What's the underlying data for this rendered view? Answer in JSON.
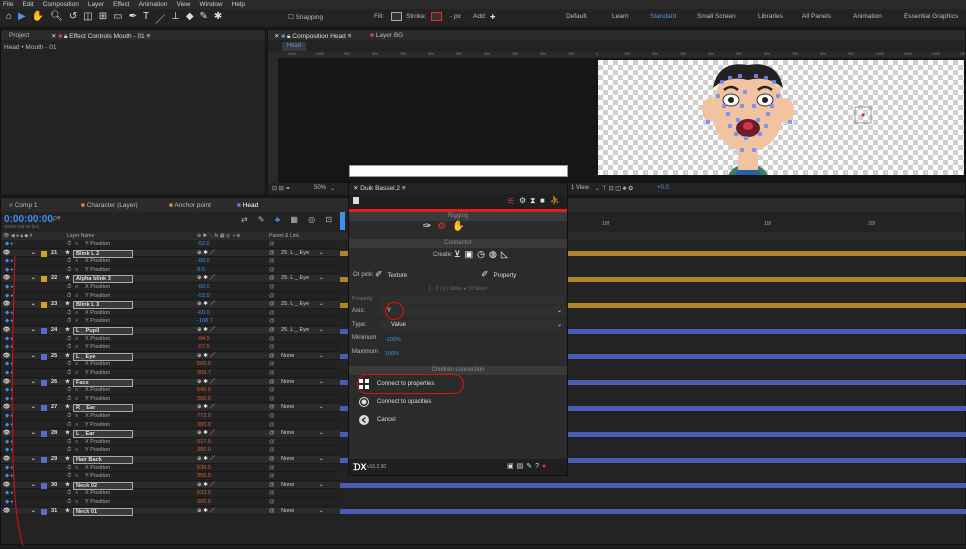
{
  "menu": [
    "File",
    "Edit",
    "Composition",
    "Layer",
    "Effect",
    "Animation",
    "View",
    "Window",
    "Help"
  ],
  "toolbar": {
    "snapping": "Snapping",
    "fill": "Fill:",
    "stroke": "Stroke:",
    "px": "- px",
    "add": "Add:",
    "workspaces": [
      "Default",
      "Learn",
      "Standard",
      "Small Screen",
      "Libraries",
      "All Panels",
      "Animation",
      "Essential Graphics"
    ],
    "active_workspace": "Standard"
  },
  "project": {
    "tab": "Project",
    "effect_tab": "Effect Controls Mouth - 01",
    "subtitle": "Head • Mouth - 01"
  },
  "composition": {
    "tab": "Composition Head",
    "layer_tab": "Layer BG",
    "comp_btn": "Head",
    "zoom": "50%",
    "view": "1 View",
    "offset": "+0.0",
    "ruler_ticks": [
      "1100",
      "1000",
      "900",
      "800",
      "700",
      "600",
      "500",
      "400",
      "300",
      "200",
      "100",
      "0",
      "100",
      "200",
      "300",
      "400",
      "500",
      "600",
      "700",
      "800",
      "900",
      "1000",
      "1100",
      "1200",
      "1300"
    ]
  },
  "timeline": {
    "tabs": [
      "Comp 1",
      "Character (Layer)",
      "Anchor point",
      "Head"
    ],
    "timecode": "0:00:00:00",
    "fps": "00000 (25.00 fps)",
    "col_headers": {
      "layer_name": "Layer Name",
      "parent": "Parent & Link"
    },
    "ruler": [
      "10f",
      "15f",
      "20f"
    ],
    "rows": [
      {
        "kind": "prop",
        "name": "Y Position",
        "value": "-52.0",
        "vclass": ""
      },
      {
        "kind": "layer",
        "num": "21",
        "name": "Blink L 2",
        "parent": "25. L _ Eye",
        "color": "#d3a020"
      },
      {
        "kind": "prop",
        "name": "X Position",
        "value": "-60.0",
        "vclass": ""
      },
      {
        "kind": "prop",
        "name": "Y Position",
        "value": "8.0",
        "vclass": ""
      },
      {
        "kind": "layer",
        "num": "22",
        "name": "Alpha blink 3",
        "parent": "25. L _ Eye",
        "color": "#d3a020"
      },
      {
        "kind": "prop",
        "name": "X Position",
        "value": "-60.0",
        "vclass": ""
      },
      {
        "kind": "prop",
        "name": "Y Position",
        "value": "-52.0",
        "vclass": ""
      },
      {
        "kind": "layer",
        "num": "23",
        "name": "Blink L 3",
        "parent": "25. L _ Eye",
        "color": "#d3a020"
      },
      {
        "kind": "prop",
        "name": "X Position",
        "value": "-60.0",
        "vclass": ""
      },
      {
        "kind": "prop",
        "name": "Y Position",
        "value": "-108.7",
        "vclass": ""
      },
      {
        "kind": "layer",
        "num": "24",
        "name": "L _ Pupil",
        "parent": "25. L _ Eye",
        "color": "#5a6ad0"
      },
      {
        "kind": "prop",
        "name": "X Position",
        "value": "-94.5",
        "vclass": "red"
      },
      {
        "kind": "prop",
        "name": "Y Position",
        "value": "-57.5",
        "vclass": "red"
      },
      {
        "kind": "layer",
        "num": "25",
        "name": "L _ Eye",
        "parent": "None",
        "color": "#5a6ad0"
      },
      {
        "kind": "prop",
        "name": "X Position",
        "value": "565.0",
        "vclass": "red"
      },
      {
        "kind": "prop",
        "name": "Y Position",
        "value": "305.7",
        "vclass": "red"
      },
      {
        "kind": "layer",
        "num": "26",
        "name": "Face",
        "parent": "None",
        "color": "#5a6ad0"
      },
      {
        "kind": "prop",
        "name": "X Position",
        "value": "640.0",
        "vclass": "red"
      },
      {
        "kind": "prop",
        "name": "Y Position",
        "value": "360.0",
        "vclass": "red"
      },
      {
        "kind": "layer",
        "num": "27",
        "name": "R _ Ear",
        "parent": "None",
        "color": "#5a6ad0"
      },
      {
        "kind": "prop",
        "name": "X Position",
        "value": "772.0",
        "vclass": "red"
      },
      {
        "kind": "prop",
        "name": "Y Position",
        "value": "300.0",
        "vclass": "red"
      },
      {
        "kind": "layer",
        "num": "28",
        "name": "L _ Ear",
        "parent": "None",
        "color": "#5a6ad0"
      },
      {
        "kind": "prop",
        "name": "X Position",
        "value": "517.0",
        "vclass": "red"
      },
      {
        "kind": "prop",
        "name": "Y Position",
        "value": "300.0",
        "vclass": "red"
      },
      {
        "kind": "layer",
        "num": "29",
        "name": "Hair Back",
        "parent": "None",
        "color": "#5a6ad0"
      },
      {
        "kind": "prop",
        "name": "X Position",
        "value": "639.5",
        "vclass": "red"
      },
      {
        "kind": "prop",
        "name": "Y Position",
        "value": "355.5",
        "vclass": "red"
      },
      {
        "kind": "layer",
        "num": "30",
        "name": "Neck 02",
        "parent": "None",
        "color": "#5a6ad0"
      },
      {
        "kind": "prop",
        "name": "X Position",
        "value": "633.9",
        "vclass": "red"
      },
      {
        "kind": "prop",
        "name": "Y Position",
        "value": "360.0",
        "vclass": "red"
      },
      {
        "kind": "layer",
        "num": "31",
        "name": "Neck 01",
        "parent": "None",
        "color": "#5a6ad0"
      }
    ]
  },
  "duik": {
    "title": "Duik Bassel.2",
    "rigging": "Rigging",
    "connector": "Connector",
    "create": "Create:",
    "or_pick": "Or pick:",
    "texture": "Texture",
    "property": "Property",
    "hint": "1 - 3 | 10 Slider ● 10 Slider",
    "property_label": "Property",
    "axis_label": "Axis:",
    "axis_value": "Y",
    "type_label": "Type:",
    "type_value": "Value",
    "minimum_label": "Minimum",
    "minimum_value": "-100%",
    "maximum_label": "Maximum",
    "maximum_value": "100%",
    "children_connection": "Children connection",
    "connect_properties": "Connect to properties",
    "connect_opacities": "Connect to opacities",
    "cancel": "Cancel",
    "version": "v16.2.30"
  }
}
